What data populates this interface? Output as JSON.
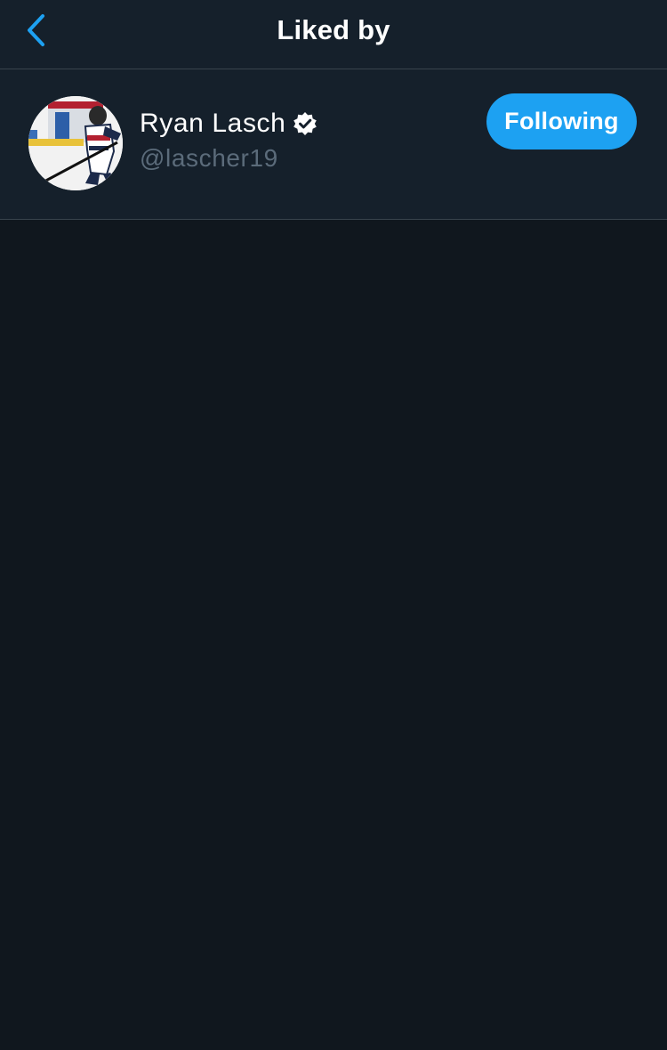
{
  "header": {
    "title": "Liked by",
    "back_icon": "chevron-left-icon"
  },
  "liked_by": [
    {
      "display_name": "Ryan Lasch",
      "handle": "@lascher19",
      "verified": true,
      "follow_state": "Following"
    }
  ],
  "colors": {
    "background": "#10171e",
    "surface": "#15202b",
    "divider": "#38444d",
    "accent": "#1da1f2",
    "secondary_text": "#5b6b7a"
  }
}
